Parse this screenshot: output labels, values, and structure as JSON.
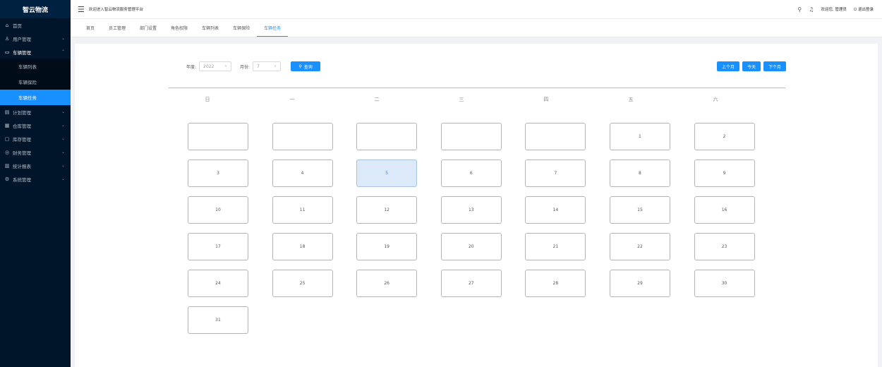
{
  "sidebar": {
    "logo": "智云物流",
    "items": [
      {
        "label": "首页",
        "icon": "⌂"
      },
      {
        "label": "用户管理",
        "icon": "♙"
      },
      {
        "label": "车辆管理",
        "icon": "▭"
      },
      {
        "label": "计划管理",
        "icon": "▤"
      },
      {
        "label": "仓库管理",
        "icon": "▦"
      },
      {
        "label": "库存管理",
        "icon": "▢"
      },
      {
        "label": "财务管理",
        "icon": "◎"
      },
      {
        "label": "统计报表",
        "icon": "▥"
      },
      {
        "label": "系统管理",
        "icon": "⚙"
      }
    ],
    "submenu": [
      {
        "label": "车辆列表"
      },
      {
        "label": "车辆保险"
      },
      {
        "label": "车辆任务"
      }
    ]
  },
  "header": {
    "welcome": "欢迎进入智云物流服务管理平台",
    "user": "欢迎您, 管理员",
    "logout": "退出登录"
  },
  "tabs": [
    "首页",
    "员工管理",
    "部门设置",
    "角色权限",
    "车辆列表",
    "车辆保险",
    "车辆任务"
  ],
  "filter": {
    "year_label": "年度:",
    "year_value": "2022",
    "month_label": "月份:",
    "month_value": "7",
    "query_label": "查询"
  },
  "nav": {
    "prev": "上个月",
    "today": "今天",
    "next": "下个月"
  },
  "weekdays": [
    "日",
    "一",
    "二",
    "三",
    "四",
    "五",
    "六"
  ],
  "calendar": {
    "leading_blanks": 5,
    "days": [
      "1",
      "2",
      "3",
      "4",
      "5",
      "6",
      "7",
      "8",
      "9",
      "10",
      "11",
      "12",
      "13",
      "14",
      "15",
      "16",
      "17",
      "18",
      "19",
      "20",
      "21",
      "22",
      "23",
      "24",
      "25",
      "26",
      "27",
      "28",
      "29",
      "30",
      "31"
    ],
    "highlight_day": "5"
  },
  "colors": {
    "sidebar_bg": "#001529",
    "primary": "#1890ff",
    "today_bg": "#dbe9f8"
  }
}
